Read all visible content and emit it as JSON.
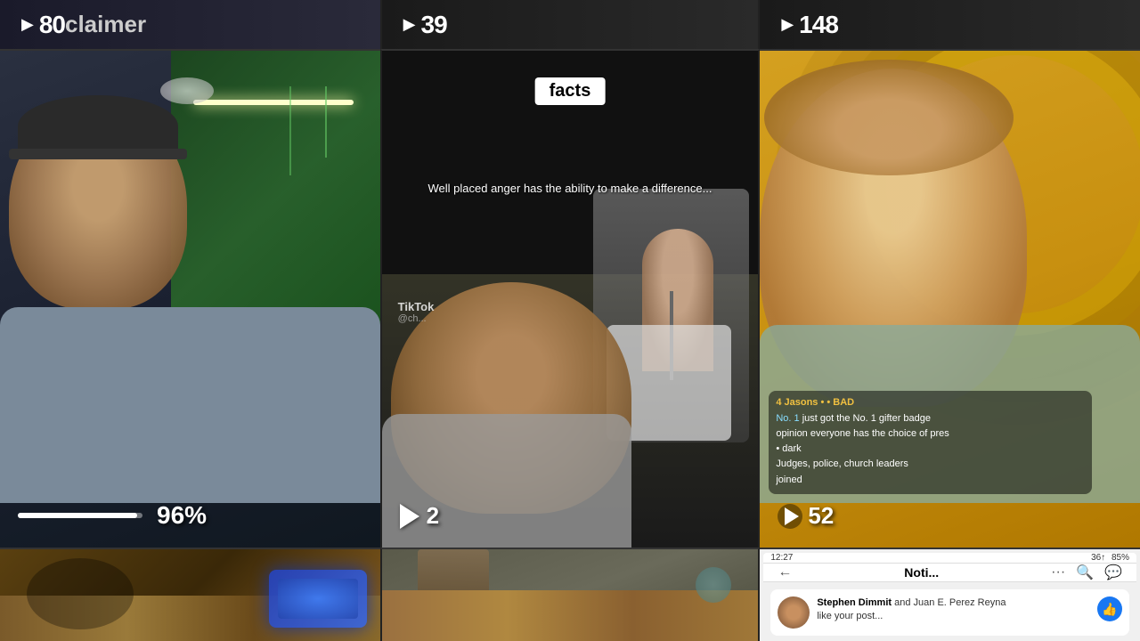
{
  "grid": {
    "top_left": {
      "play_icon": "▶",
      "count": "80",
      "suffix": "claimer"
    },
    "top_center": {
      "play_icon": "▶",
      "count": "39"
    },
    "top_right": {
      "play_icon": "▶",
      "count": "148"
    },
    "mid_left": {
      "progress_pct": "96%"
    },
    "mid_center": {
      "facts_label": "facts",
      "subtitle_line1": "Well placed anger has the ability to make a",
      "subtitle_line2": "difference...",
      "play_icon": "▶",
      "play_count": "2",
      "tiktok_label": "TikT...",
      "tiktok_user": "@ch..."
    },
    "mid_right": {
      "song_label": "• BAD",
      "badge_label": "just got the No. 1 gifter badge",
      "chat_line1": "opinion everyone has the choice of pres",
      "chat_line2": "• dark",
      "chat_line3": "Judges, police, church leaders",
      "chat_line4": "joined",
      "play_icon": "▶",
      "play_count": "52"
    },
    "bot_right": {
      "status_time": "12:27",
      "status_icons": "■■■ •",
      "status_signal": "36↑",
      "status_battery": "85%",
      "nav_back": "←",
      "nav_title": "Noti...",
      "nav_menu": "···",
      "nav_search": "🔍",
      "nav_messenger": "💬",
      "notif_name1": "Stephen Dimmit",
      "notif_text1": "and Juan E. Perez Reyna",
      "notif_text2": "like your post..."
    }
  }
}
